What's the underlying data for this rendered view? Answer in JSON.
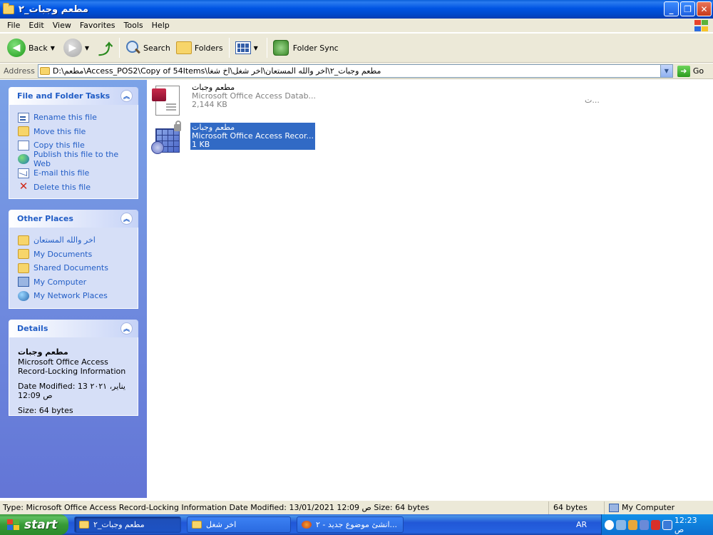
{
  "window": {
    "title": "مطعم وجبات_٢"
  },
  "menu": [
    "File",
    "Edit",
    "View",
    "Favorites",
    "Tools",
    "Help"
  ],
  "toolbar": {
    "back": "Back",
    "search": "Search",
    "folders": "Folders",
    "folder_sync": "Folder Sync"
  },
  "address": {
    "label": "Address",
    "path": "D:\\مطعم\\Access_POS2\\Copy of 54Items\\مطعم وجبات_٢\\اخر والله المستعان\\اخر شغل\\اخ شغا",
    "go": "Go"
  },
  "tasks_panel": {
    "title": "File and Folder Tasks",
    "items": [
      "Rename this file",
      "Move this file",
      "Copy this file",
      "Publish this file to the Web",
      "E-mail this file",
      "Delete this file"
    ]
  },
  "places_panel": {
    "title": "Other Places",
    "items": [
      "اخر والله المستعان",
      "My Documents",
      "Shared Documents",
      "My Computer",
      "My Network Places"
    ]
  },
  "details_panel": {
    "title": "Details",
    "name": "مطعم وجبات",
    "type_line1": "Microsoft Office Access",
    "type_line2": "Record-Locking Information",
    "modified_line1": "Date Modified: 13 يناير، ٢٠٢١",
    "modified_line2": "12:09 ص",
    "size": "Size: 64 bytes"
  },
  "files": [
    {
      "name": "مطعم وجبات",
      "type": "Microsoft Office Access Datab...",
      "size": "2,144 KB",
      "selected": false
    },
    {
      "name": "مطعم وجبات",
      "type": "Microsoft Office Access Recor...",
      "size": "1 KB",
      "selected": true
    }
  ],
  "stray_text": "ت...",
  "statusbar": {
    "main": "Type: Microsoft Office Access Record-Locking Information Date Modified: 13/01/2021 12:09 ص Size: 64 bytes",
    "size": "64 bytes",
    "zone": "My Computer"
  },
  "taskbar": {
    "start": "start",
    "buttons": [
      "مطعم وجبات_٢",
      "اخر شغل",
      "انشئ موضوع جديد - ٢..."
    ],
    "lang": "AR",
    "clock": "12:23 ص"
  }
}
